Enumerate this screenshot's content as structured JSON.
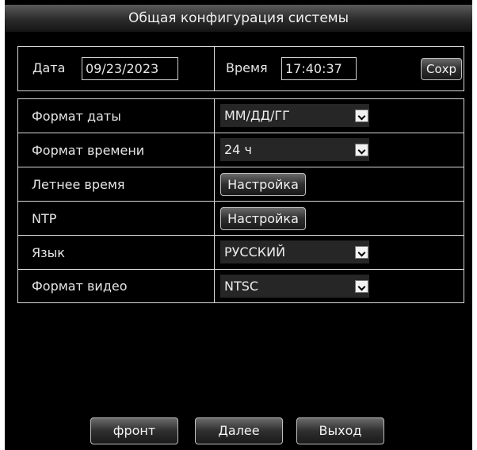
{
  "title": "Общая конфигурация системы",
  "datetime": {
    "date_label": "Дата",
    "date_value": "09/23/2023",
    "time_label": "Время",
    "time_value": "17:40:37",
    "save_label": "Сохр"
  },
  "settings": {
    "date_format": {
      "label": "Формат даты",
      "value": "ММ/ДД/ГГ"
    },
    "time_format": {
      "label": "Формат времени",
      "value": "24 ч"
    },
    "dst": {
      "label": "Летнее время",
      "button": "Настройка"
    },
    "ntp": {
      "label": "NTP",
      "button": "Настройка"
    },
    "language": {
      "label": "Язык",
      "value": "РУССКИЙ"
    },
    "video_format": {
      "label": "Формат видео",
      "value": "NTSC"
    }
  },
  "footer": {
    "front_label": "фронт",
    "next_label": "Далее",
    "exit_label": "Выход"
  }
}
